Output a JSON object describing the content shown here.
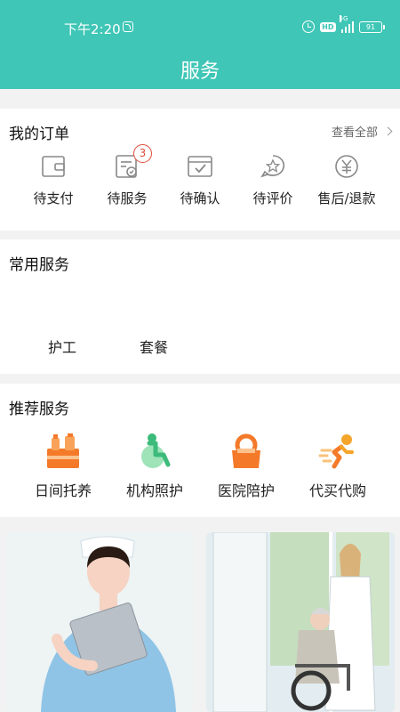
{
  "status_bar": {
    "time": "下午2:20",
    "network": "5G",
    "hd": "HD",
    "battery": "91"
  },
  "header": {
    "title": "服务"
  },
  "orders": {
    "title": "我的订单",
    "see_all": "查看全部",
    "items": [
      {
        "label": "待支付",
        "icon": "wallet-icon"
      },
      {
        "label": "待服务",
        "icon": "service-doc-icon",
        "badge": "3"
      },
      {
        "label": "待确认",
        "icon": "confirm-calendar-icon"
      },
      {
        "label": "待评价",
        "icon": "star-bubble-icon"
      },
      {
        "label": "售后/退款",
        "icon": "yen-refund-icon"
      }
    ]
  },
  "common_services": {
    "title": "常用服务",
    "items": [
      {
        "label": "护工"
      },
      {
        "label": "套餐"
      }
    ]
  },
  "recommended": {
    "title": "推荐服务",
    "items": [
      {
        "label": "日间托养",
        "icon": "daycare-bottles-icon"
      },
      {
        "label": "机构照护",
        "icon": "wheelchair-icon"
      },
      {
        "label": "医院陪护",
        "icon": "hospital-bag-icon"
      },
      {
        "label": "代买代购",
        "icon": "running-courier-icon"
      }
    ]
  },
  "banners": [
    {
      "name": "nurse-banner",
      "subject": "nurse"
    },
    {
      "name": "caregiver-banner",
      "subject": "doctor-with-elderly-in-wheelchair"
    }
  ],
  "colors": {
    "primary": "#3fc6b6",
    "badge": "#e04b3a",
    "accent_orange": "#f47a2a",
    "accent_green": "#3dbb7a"
  }
}
